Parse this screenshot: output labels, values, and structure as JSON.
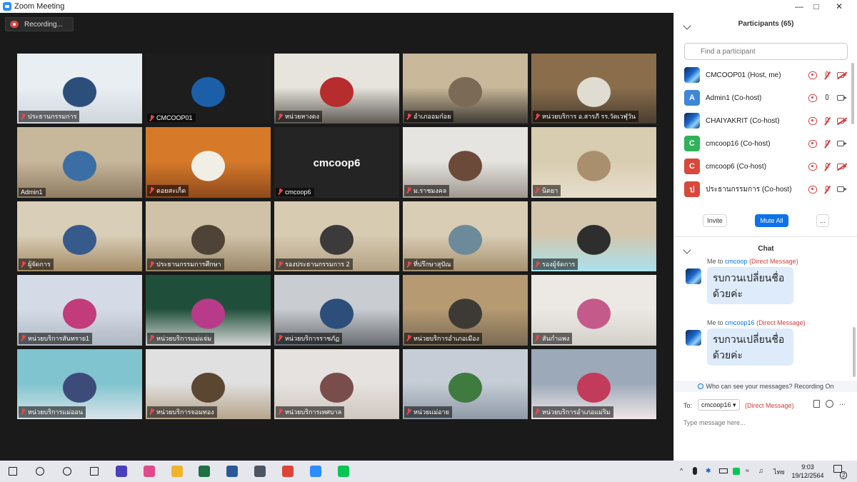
{
  "window": {
    "title": "Zoom Meeting",
    "minimize": "—",
    "maximize": "□",
    "close": "✕"
  },
  "recording": {
    "label": "Recording..."
  },
  "tiles": [
    {
      "name": "ประธานกรรมการ",
      "colors": [
        "#e9eef3",
        "#2b4f7a",
        "#cfd6dc"
      ]
    },
    {
      "name": "CMCOOP01",
      "colors": [
        "#1d1d1d",
        "#1b5fa8",
        "#1d1d1d"
      ]
    },
    {
      "name": "หน่วยหางดง",
      "colors": [
        "#e7e4de",
        "#b62d2d",
        "#5f5a55"
      ]
    },
    {
      "name": "อำเภออมก๋อย",
      "colors": [
        "#c9b89a",
        "#7b6a55",
        "#3f3a34"
      ]
    },
    {
      "name": "หน่วยบริการ อ.สารภี รร.วัดเวฬุวัน",
      "colors": [
        "#8a6e4c",
        "#e0dcd2",
        "#4a3e30"
      ]
    },
    {
      "name": "Admin1",
      "colors": [
        "#c7b79b",
        "#3a6ea5",
        "#8f7c62"
      ]
    },
    {
      "name": "ดอยสะเก็ด",
      "colors": [
        "#d67a2a",
        "#f1eee6",
        "#8f4a1c"
      ]
    },
    {
      "name": "cmcoop6",
      "colors": [
        "#242424",
        "#242424",
        "#242424"
      ],
      "big": "cmcoop6"
    },
    {
      "name": "ม.ราชมงคล",
      "colors": [
        "#e6e4e0",
        "#6b4a3a",
        "#a09890"
      ]
    },
    {
      "name": "นิตยา",
      "colors": [
        "#d8ccb1",
        "#a98f6e",
        "#e7dfcc"
      ]
    },
    {
      "name": "ผู้จัดการ",
      "colors": [
        "#d9ceb7",
        "#365a8c",
        "#a48b66"
      ]
    },
    {
      "name": "ประธานกรรมการศึกษา",
      "colors": [
        "#cfc2a8",
        "#4f4236",
        "#9a876a"
      ]
    },
    {
      "name": "รองประธานกรรมการ 2",
      "colors": [
        "#d7cbb2",
        "#3c3a3a",
        "#b3a184"
      ]
    },
    {
      "name": "ที่ปรึกษาสุปัณ",
      "colors": [
        "#d9cdb5",
        "#6d8a9a",
        "#a7916f"
      ]
    },
    {
      "name": "รองผู้จัดการ",
      "colors": [
        "#d3c6ad",
        "#2e2e2e",
        "#a9e2ec"
      ]
    },
    {
      "name": "หน่วยบริการสันทราย1",
      "colors": [
        "#d4dbe7",
        "#c23b7a",
        "#b0b8c4"
      ]
    },
    {
      "name": "หน่วยบริการแม่แจ่ม",
      "colors": [
        "#1f4f3a",
        "#b83b8a",
        "#d7d7d7"
      ]
    },
    {
      "name": "หน่วยบริการราชภัฏ",
      "colors": [
        "#c9ccd0",
        "#2b4f7a",
        "#6a6d72"
      ]
    },
    {
      "name": "หน่วยบริการอำเภอเมือง",
      "colors": [
        "#b59a72",
        "#3d3a36",
        "#7c6b55"
      ]
    },
    {
      "name": "สันกำแพง",
      "colors": [
        "#ece9e4",
        "#c45a8a",
        "#d4d0ca"
      ]
    },
    {
      "name": "หน่วยบริการแม่ออน",
      "colors": [
        "#7fc4cf",
        "#3d4b7a",
        "#d9e3e8"
      ]
    },
    {
      "name": "หน่วยบริการจอมทอง",
      "colors": [
        "#e0e0e0",
        "#5b4632",
        "#b7a58c"
      ]
    },
    {
      "name": "หน่วยบริการเทศบาล",
      "colors": [
        "#e5e2df",
        "#7a4d4d",
        "#d0c7c0"
      ]
    },
    {
      "name": "หน่วยแม่อาย",
      "colors": [
        "#c6cdd6",
        "#3f7a3f",
        "#8f9aa7"
      ]
    },
    {
      "name": "หน่วยบริการอำเภอแม่ริม",
      "colors": [
        "#9ba9b8",
        "#c23b5a",
        "#f0e6e6"
      ]
    }
  ],
  "participants": {
    "title": "Participants (65)",
    "search_placeholder": "Find a participant",
    "list": [
      {
        "name": "CMCOOP01 (Host, me)",
        "avatar": "",
        "avatar_color": "#1e67c9",
        "mic": "off",
        "cam": "off"
      },
      {
        "name": "Admin1 (Co-host)",
        "avatar": "A",
        "avatar_color": "#3e86d6",
        "mic": "on",
        "cam": "on"
      },
      {
        "name": "CHAIYAKRIT (Co-host)",
        "avatar": "",
        "avatar_color": "#1e67c9",
        "mic": "off",
        "cam": "off"
      },
      {
        "name": "cmcoop16 (Co-host)",
        "avatar": "C",
        "avatar_color": "#2fb25a",
        "mic": "off",
        "cam": "on"
      },
      {
        "name": "cmcoop6 (Co-host)",
        "avatar": "C",
        "avatar_color": "#d9483b",
        "mic": "off",
        "cam": "off"
      },
      {
        "name": "ประธานกรรมการ (Co-host)",
        "avatar": "ป",
        "avatar_color": "#d9483b",
        "mic": "off",
        "cam": "on"
      }
    ],
    "invite_label": "Invite",
    "mute_all_label": "Mute All",
    "more_label": "..."
  },
  "chat": {
    "title": "Chat",
    "messages": [
      {
        "from": "Me to",
        "to": "cmcoop",
        "dm": "(Direct Message)",
        "text": "รบกวนเปลี่ยนชื่อด้วยค่ะ"
      },
      {
        "from": "Me to",
        "to": "cmcoop16",
        "dm": "(Direct Message)",
        "text": "รบกวนเปลี่ยนชื่อด้วยค่ะ"
      }
    ],
    "who_can_see": "Who can see your messages? Recording On",
    "to_label": "To:",
    "to_value": "cmcoop16",
    "to_dm": "(Direct Message)",
    "more": "...",
    "input_placeholder": "Type message here..."
  },
  "taskbar": {
    "apps": [
      {
        "name": "windows-start",
        "color": "#1b1b1b"
      },
      {
        "name": "search",
        "color": "#1b1b1b"
      },
      {
        "name": "cortana",
        "color": "#1b1b1b"
      },
      {
        "name": "task-view",
        "color": "#1b1b1b"
      },
      {
        "name": "app-m",
        "color": "#4a3fbf"
      },
      {
        "name": "app-drop",
        "color": "#e04a8a"
      },
      {
        "name": "file-explorer",
        "color": "#f0b429"
      },
      {
        "name": "excel",
        "color": "#1e7145"
      },
      {
        "name": "word",
        "color": "#2b579a"
      },
      {
        "name": "calculator",
        "color": "#4b5563"
      },
      {
        "name": "chrome",
        "color": "#db4437"
      },
      {
        "name": "zoom",
        "color": "#2d8cff"
      },
      {
        "name": "line",
        "color": "#06c755"
      }
    ],
    "lang": "ไทย",
    "time": "9:03",
    "date": "19/12/2564",
    "notif": "2"
  }
}
